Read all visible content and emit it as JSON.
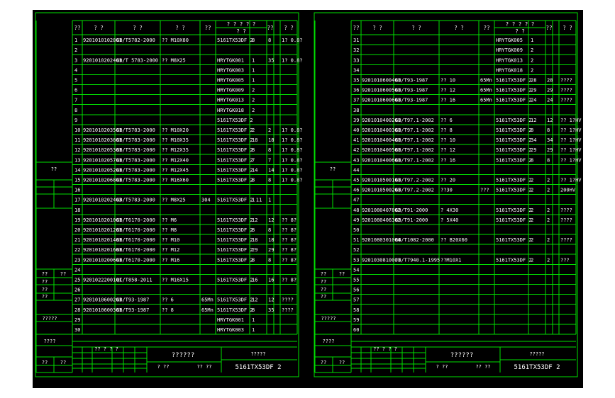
{
  "app": {
    "title": "CAD parts list drawing",
    "background": "#000000",
    "line_color": "#00e000",
    "text_color": "#ffffff"
  },
  "header": {
    "no": "??",
    "code": "? ?",
    "standard": "? ?",
    "name": "? ?",
    "qty": "??",
    "material": "? ? ? ? ?",
    "material_sub": "? ?",
    "weight": "??",
    "note": "? ?"
  },
  "left_sheet": {
    "rows": [
      {
        "no": "1",
        "code": "9201010102801",
        "std": "GB/T5782-2000",
        "name": "?? M10X80",
        "mat": "",
        "part": "5161TX53DF 2",
        "a": "8",
        "b": "8",
        "note": "1? 0.8?"
      },
      {
        "no": "2",
        "code": "",
        "std": "",
        "name": "",
        "mat": "",
        "part": "",
        "a": "",
        "b": "",
        "note": ""
      },
      {
        "no": "3",
        "code": "9201010202401",
        "std": "GB/T 5783-2000",
        "name": "?? M8X25",
        "mat": "",
        "part": "HRYTGK001",
        "a": "1",
        "b": "35",
        "note": "1? 0.8?"
      },
      {
        "no": "4",
        "code": "",
        "std": "",
        "name": "",
        "mat": "",
        "part": "HRYTGK003",
        "a": "1",
        "b": "",
        "note": ""
      },
      {
        "no": "5",
        "code": "",
        "std": "",
        "name": "",
        "mat": "",
        "part": "HRYTGK005",
        "a": "1",
        "b": "",
        "note": ""
      },
      {
        "no": "6",
        "code": "",
        "std": "",
        "name": "",
        "mat": "",
        "part": "HRYTGK009",
        "a": "2",
        "b": "",
        "note": ""
      },
      {
        "no": "7",
        "code": "",
        "std": "",
        "name": "",
        "mat": "",
        "part": "HRYTGK013",
        "a": "2",
        "b": "",
        "note": ""
      },
      {
        "no": "8",
        "code": "",
        "std": "",
        "name": "",
        "mat": "",
        "part": "HRYTGK018",
        "a": "2",
        "b": "",
        "note": ""
      },
      {
        "no": "9",
        "code": "",
        "std": "",
        "name": "",
        "mat": "",
        "part": "5161TX53DF 2",
        "a": "",
        "b": "",
        "note": ""
      },
      {
        "no": "10",
        "code": "9201010203501",
        "std": "GB/T5783-2000",
        "name": "?? M10X20",
        "mat": "",
        "part": "5161TX53DF 2",
        "a": "2",
        "b": "2",
        "note": "1? 0.8?"
      },
      {
        "no": "11",
        "code": "9201010203801",
        "std": "GB/T5783-2000",
        "name": "?? M10X35",
        "mat": "",
        "part": "5161TX53DF 2",
        "a": "18",
        "b": "18",
        "note": "1? 0.8?"
      },
      {
        "no": "12",
        "code": "9201010205301",
        "std": "GB/T5783-2000",
        "name": "?? M12X35",
        "mat": "",
        "part": "5161TX53DF 2",
        "a": "8",
        "b": "8",
        "note": "1? 0.8?"
      },
      {
        "no": "13",
        "code": "9201010205701",
        "std": "GB/T5783-2000",
        "name": "?? M12X40",
        "mat": "",
        "part": "5161TX53DF 2",
        "a": "7",
        "b": "7",
        "note": "1? 0.8?"
      },
      {
        "no": "14",
        "code": "9201010205201",
        "std": "GB/T5783-2000",
        "name": "?? M12X45",
        "mat": "",
        "part": "5161TX53DF 2",
        "a": "14",
        "b": "14",
        "note": "1? 0.8?"
      },
      {
        "no": "15",
        "code": "9201010206801",
        "std": "GB/T5783-2000",
        "name": "?? M16X60",
        "mat": "",
        "part": "5161TX53DF 2",
        "a": "8",
        "b": "8",
        "note": "1? 0.8?"
      },
      {
        "no": "16",
        "code": "",
        "std": "",
        "name": "",
        "mat": "",
        "part": "",
        "a": "",
        "b": "",
        "note": ""
      },
      {
        "no": "17",
        "code": "9201010202403",
        "std": "GB/T5783-2000",
        "name": "?? M8X25",
        "mat": "304",
        "part": "5161TX53DF 2 11",
        "a": "1",
        "b": "1",
        "note": ""
      },
      {
        "no": "18",
        "code": "",
        "std": "",
        "name": "",
        "mat": "",
        "part": "",
        "a": "",
        "b": "",
        "note": ""
      },
      {
        "no": "19",
        "code": "9201010201001",
        "std": "GB/T6170-2000",
        "name": "?? M6",
        "mat": "",
        "part": "5161TX53DF 2",
        "a": "12",
        "b": "12",
        "note": "?? 8?"
      },
      {
        "no": "20",
        "code": "9201010201201",
        "std": "GB/T6170-2000",
        "name": "?? M8",
        "mat": "",
        "part": "5161TX53DF 2",
        "a": "8",
        "b": "8",
        "note": "?? 8?"
      },
      {
        "no": "21",
        "code": "9201010201401",
        "std": "GB/T6170-2000",
        "name": "?? M10",
        "mat": "",
        "part": "5161TX53DF 2",
        "a": "18",
        "b": "18",
        "note": "?? 8?"
      },
      {
        "no": "22",
        "code": "9201010201601",
        "std": "GB/T6170-2000",
        "name": "?? M12",
        "mat": "",
        "part": "5161TX53DF 2",
        "a": "29",
        "b": "29",
        "note": "?? 8?"
      },
      {
        "no": "23",
        "code": "9201010200601",
        "std": "GB/T6170-2000",
        "name": "?? M16",
        "mat": "",
        "part": "5161TX53DF 2",
        "a": "8",
        "b": "8",
        "note": "?? 8?"
      },
      {
        "no": "24",
        "code": "",
        "std": "",
        "name": "",
        "mat": "",
        "part": "",
        "a": "",
        "b": "",
        "note": ""
      },
      {
        "no": "25",
        "code": "9201022200101",
        "std": "QC/T858-2011",
        "name": "?? M16X15",
        "mat": "",
        "part": "5161TX53DF 2",
        "a": "16",
        "b": "16",
        "note": "?? 8?"
      },
      {
        "no": "26",
        "code": "",
        "std": "",
        "name": "",
        "mat": "",
        "part": "",
        "a": "",
        "b": "",
        "note": ""
      },
      {
        "no": "27",
        "code": "9201010600201",
        "std": "GB/T93-1987",
        "name": "?? 6",
        "mat": "65Mn",
        "part": "5161TX53DF 2",
        "a": "12",
        "b": "12",
        "note": "????"
      },
      {
        "no": "28",
        "code": "9201010600301",
        "std": "GB/T93-1987",
        "name": "?? 8",
        "mat": "65Mn",
        "part": "5161TX53DF 2",
        "a": "8",
        "b": "35",
        "note": "????"
      },
      {
        "no": "29",
        "code": "",
        "std": "",
        "name": "",
        "mat": "",
        "part": "HRYTGK001",
        "a": "1",
        "b": "",
        "note": ""
      },
      {
        "no": "30",
        "code": "",
        "std": "",
        "name": "",
        "mat": "",
        "part": "HRYTGK003",
        "a": "1",
        "b": "",
        "note": ""
      }
    ],
    "side_labels": [
      "??",
      "??",
      "??",
      "??",
      "??",
      "??",
      "?????",
      "????",
      "??",
      "??"
    ],
    "title_block": {
      "name": "??????",
      "part": "5161TX53DF 2",
      "group": "?????",
      "sign": "?? ??",
      "date": "? ??",
      "small": "?? ? ? ?"
    }
  },
  "right_sheet": {
    "rows": [
      {
        "no": "31",
        "code": "",
        "std": "",
        "name": "",
        "mat": "",
        "part": "HRYTGK005",
        "a": "1",
        "b": "",
        "note": ""
      },
      {
        "no": "32",
        "code": "",
        "std": "",
        "name": "",
        "mat": "",
        "part": "HRYTGK009",
        "a": "2",
        "b": "",
        "note": ""
      },
      {
        "no": "33",
        "code": "",
        "std": "",
        "name": "",
        "mat": "",
        "part": "HRYTGK013",
        "a": "2",
        "b": "",
        "note": ""
      },
      {
        "no": "34",
        "code": "",
        "std": "",
        "name": "",
        "mat": "",
        "part": "HRYTGK018",
        "a": "2",
        "b": "",
        "note": ""
      },
      {
        "no": "35",
        "code": "9201010600401",
        "std": "GB/T93-1987",
        "name": "?? 10",
        "mat": "65Mn",
        "part": "5161TX53DF 2",
        "a": "28",
        "b": "28",
        "note": "????"
      },
      {
        "no": "36",
        "code": "9201010600501",
        "std": "GB/T93-1987",
        "name": "?? 12",
        "mat": "65Mn",
        "part": "5161TX53DF 2",
        "a": "29",
        "b": "29",
        "note": "????"
      },
      {
        "no": "37",
        "code": "9201010600601",
        "std": "GB/T93-1987",
        "name": "?? 16",
        "mat": "65Mn",
        "part": "5161TX53DF 2",
        "a": "24",
        "b": "24",
        "note": "????"
      },
      {
        "no": "38",
        "code": "",
        "std": "",
        "name": "",
        "mat": "",
        "part": "",
        "a": "",
        "b": "",
        "note": ""
      },
      {
        "no": "39",
        "code": "9201010400201",
        "std": "GB/T97.1-2002",
        "name": "?? 6",
        "mat": "",
        "part": "5161TX53DF 2",
        "a": "12",
        "b": "12",
        "note": "?? 1?HV"
      },
      {
        "no": "40",
        "code": "9201010400301",
        "std": "GB/T97.1-2002",
        "name": "?? 8",
        "mat": "",
        "part": "5161TX53DF 2",
        "a": "8",
        "b": "8",
        "note": "?? 1?HV"
      },
      {
        "no": "41",
        "code": "9201010400401",
        "std": "GB/T97.1-2002",
        "name": "?? 10",
        "mat": "",
        "part": "5161TX53DF 2",
        "a": "34",
        "b": "34",
        "note": "?? 1?HV"
      },
      {
        "no": "42",
        "code": "9201010400501",
        "std": "GB/T97.1-2002",
        "name": "?? 12",
        "mat": "",
        "part": "5161TX53DF 2",
        "a": "29",
        "b": "29",
        "note": "?? 1?HV"
      },
      {
        "no": "43",
        "code": "9201010400601",
        "std": "GB/T97.1-2002",
        "name": "?? 16",
        "mat": "",
        "part": "5161TX53DF 2",
        "a": "8",
        "b": "8",
        "note": "?? 1?HV"
      },
      {
        "no": "44",
        "code": "",
        "std": "",
        "name": "",
        "mat": "",
        "part": "",
        "a": "",
        "b": "",
        "note": ""
      },
      {
        "no": "45",
        "code": "9201010500101",
        "std": "GB/T97.2-2002",
        "name": "?? 20",
        "mat": "",
        "part": "5161TX53DF 2",
        "a": "2",
        "b": "2",
        "note": "?? 1?HV"
      },
      {
        "no": "46",
        "code": "9201010500201",
        "std": "GB/T97.2-2002",
        "name": "??30",
        "mat": "???",
        "part": "5161TX53DF 2",
        "a": "2",
        "b": "2",
        "note": "200HV"
      },
      {
        "no": "47",
        "code": "",
        "std": "",
        "name": "",
        "mat": "",
        "part": "",
        "a": "",
        "b": "",
        "note": ""
      },
      {
        "no": "48",
        "code": "9201080407802",
        "std": "GB/T91-2000",
        "name": "? 4X30",
        "mat": "",
        "part": "5161TX53DF 2",
        "a": "2",
        "b": "2",
        "note": "????"
      },
      {
        "no": "49",
        "code": "9201080406302",
        "std": "GB/T91-2000",
        "name": "? 5X40",
        "mat": "",
        "part": "5161TX53DF 2",
        "a": "2",
        "b": "2",
        "note": "????"
      },
      {
        "no": "50",
        "code": "",
        "std": "",
        "name": "",
        "mat": "",
        "part": "",
        "a": "",
        "b": "",
        "note": ""
      },
      {
        "no": "51",
        "code": "9201080301004",
        "std": "GB/T1082-2000",
        "name": "?? B20X60",
        "mat": "",
        "part": "5161TX53DF 2",
        "a": "2",
        "b": "2",
        "note": "????"
      },
      {
        "no": "52",
        "code": "",
        "std": "",
        "name": "",
        "mat": "",
        "part": "",
        "a": "",
        "b": "",
        "note": ""
      },
      {
        "no": "53",
        "code": "9201030810001",
        "std": "JB/T7940.1-1995",
        "name": "??M10X1",
        "mat": "",
        "part": "5161TX53DF 2",
        "a": "2",
        "b": "2",
        "note": "???"
      },
      {
        "no": "54",
        "code": "",
        "std": "",
        "name": "",
        "mat": "",
        "part": "",
        "a": "",
        "b": "",
        "note": ""
      },
      {
        "no": "55",
        "code": "",
        "std": "",
        "name": "",
        "mat": "",
        "part": "",
        "a": "",
        "b": "",
        "note": ""
      },
      {
        "no": "56",
        "code": "",
        "std": "",
        "name": "",
        "mat": "",
        "part": "",
        "a": "",
        "b": "",
        "note": ""
      },
      {
        "no": "57",
        "code": "",
        "std": "",
        "name": "",
        "mat": "",
        "part": "",
        "a": "",
        "b": "",
        "note": ""
      },
      {
        "no": "58",
        "code": "",
        "std": "",
        "name": "",
        "mat": "",
        "part": "",
        "a": "",
        "b": "",
        "note": ""
      },
      {
        "no": "59",
        "code": "",
        "std": "",
        "name": "",
        "mat": "",
        "part": "",
        "a": "",
        "b": "",
        "note": ""
      },
      {
        "no": "60",
        "code": "",
        "std": "",
        "name": "",
        "mat": "",
        "part": "",
        "a": "",
        "b": "",
        "note": ""
      }
    ],
    "side_labels": [
      "??",
      "??",
      "??",
      "??",
      "??",
      "??",
      "?????",
      "????",
      "??",
      "??"
    ],
    "title_block": {
      "name": "??????",
      "part": "5161TX53DF 2",
      "group": "?????",
      "sign": "?? ??",
      "date": "? ??",
      "small": "?? ? ? ?"
    }
  }
}
